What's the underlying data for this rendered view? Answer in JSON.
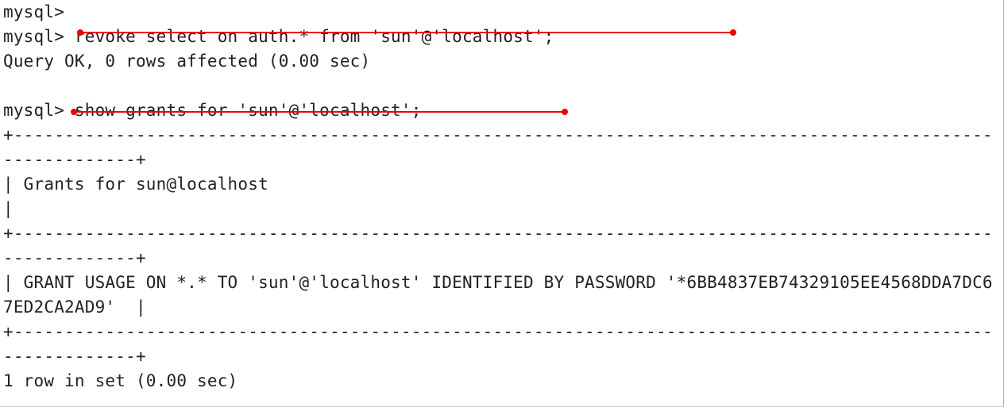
{
  "terminal": {
    "prompt": "mysql>",
    "truncated_top": "mysql>",
    "cmd1": "revoke select on auth.* from 'sun'@'localhost';",
    "resp1": "Query OK, 0 rows affected (0.00 sec)",
    "cmd2": "show grants for 'sun'@'localhost';",
    "table": {
      "border_long": "+-------------------------------------------------------------------------------------------------------------+",
      "header_row": "| Grants for sun@localhost                                                                                    |",
      "data_row": "| GRANT USAGE ON *.* TO 'sun'@'localhost' IDENTIFIED BY PASSWORD '*6BB4837EB74329105EE4568DDA7DC67ED2CA2AD9'  |"
    },
    "footer": "1 row in set (0.00 sec)"
  },
  "annotations": {
    "underline1_target": "revoke select on auth.* from 'sun'@'localhost';",
    "underline2_target": "show grants for 'sun'@'localhost';"
  }
}
